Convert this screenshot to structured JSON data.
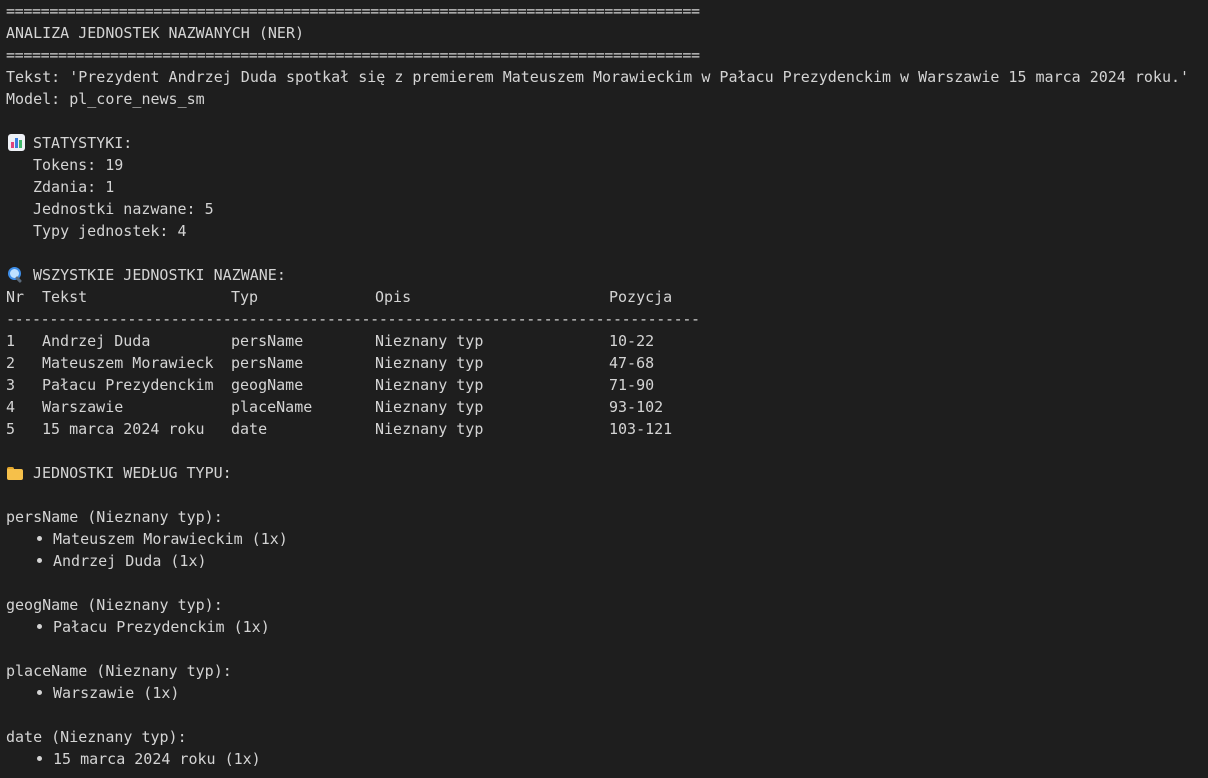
{
  "header": {
    "rule": "================================================================================",
    "title": "ANALIZA JEDNOSTEK NAZWANYCH (NER)"
  },
  "input": {
    "text_line": "Tekst: 'Prezydent Andrzej Duda spotkał się z premierem Mateuszem Morawieckim w Pałacu Prezydenckim w Warszawie 15 marca 2024 roku.'",
    "model_line": "Model: pl_core_news_sm"
  },
  "stats": {
    "icon": "bar-chart-icon",
    "heading": "STATYSTYKI:",
    "lines": [
      "Tokens: 19",
      "Zdania: 1",
      "Jednostki nazwane: 5",
      "Typy jednostek: 4"
    ]
  },
  "entities": {
    "icon": "magnifier-icon",
    "heading": "WSZYSTKIE JEDNOSTKI NAZWANE:",
    "columns": {
      "nr": "Nr",
      "tekst": "Tekst",
      "typ": "Typ",
      "opis": "Opis",
      "pozycja": "Pozycja"
    },
    "divider": "--------------------------------------------------------------------------------",
    "rows": [
      {
        "nr": "1",
        "tekst": "Andrzej Duda",
        "typ": "persName",
        "opis": "Nieznany typ",
        "pozycja": "10-22"
      },
      {
        "nr": "2",
        "tekst": "Mateuszem Morawieck",
        "typ": "persName",
        "opis": "Nieznany typ",
        "pozycja": "47-68"
      },
      {
        "nr": "3",
        "tekst": "Pałacu Prezydenckim",
        "typ": "geogName",
        "opis": "Nieznany typ",
        "pozycja": "71-90"
      },
      {
        "nr": "4",
        "tekst": "Warszawie",
        "typ": "placeName",
        "opis": "Nieznany typ",
        "pozycja": "93-102"
      },
      {
        "nr": "5",
        "tekst": "15 marca 2024 roku",
        "typ": "date",
        "opis": "Nieznany typ",
        "pozycja": "103-121"
      }
    ]
  },
  "by_type": {
    "icon": "folder-icon",
    "heading": "JEDNOSTKI WEDŁUG TYPU:",
    "groups": [
      {
        "label": "persName (Nieznany typ):",
        "items": [
          "Mateuszem Morawieckim (1x)",
          "Andrzej Duda (1x)"
        ]
      },
      {
        "label": "geogName (Nieznany typ):",
        "items": [
          "Pałacu Prezydenckim (1x)"
        ]
      },
      {
        "label": "placeName (Nieznany typ):",
        "items": [
          "Warszawie (1x)"
        ]
      },
      {
        "label": "date (Nieznany typ):",
        "items": [
          "15 marca 2024 roku (1x)"
        ]
      }
    ]
  },
  "colors": {
    "background": "#1e1e1e",
    "text": "#d4d4d4"
  }
}
